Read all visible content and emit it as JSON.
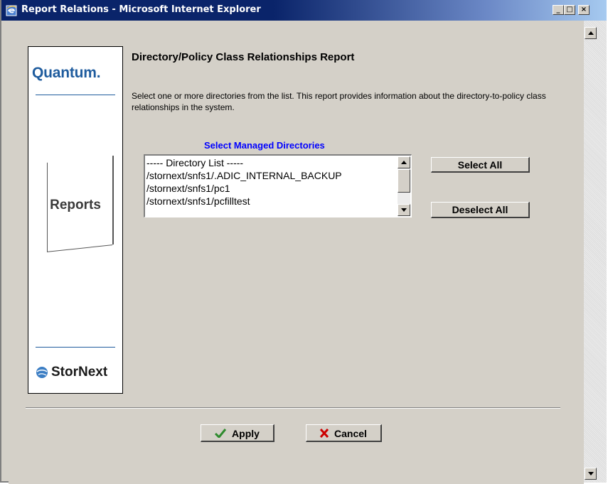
{
  "window": {
    "title": "Report Relations - Microsoft Internet Explorer",
    "minimize": "_",
    "maximize": "□",
    "close": "×"
  },
  "sidebar": {
    "quantum_logo": "Quantum.",
    "reports_label": "Reports",
    "stornext_logo": "StorNext"
  },
  "report": {
    "heading": "Directory/Policy Class Relationships Report",
    "description": "Select one or more directories from the list. This report provides information about the directory-to-policy class relationships in the system.",
    "select_label": "Select Managed Directories",
    "directories": [
      "----- Directory List -----",
      "/stornext/snfs1/.ADIC_INTERNAL_BACKUP",
      "/stornext/snfs1/pc1",
      "/stornext/snfs1/pcfilltest"
    ],
    "select_all_label": "Select All",
    "deselect_all_label": "Deselect All"
  },
  "actions": {
    "apply_label": "Apply",
    "cancel_label": "Cancel"
  },
  "colors": {
    "title_bar": "#0a246a",
    "label_blue": "#0000ff",
    "quantum_blue": "#1f5c9e",
    "apply_check": "#2e8b2e",
    "cancel_x": "#cc0000",
    "dialog_bg": "#d4d0c8"
  }
}
